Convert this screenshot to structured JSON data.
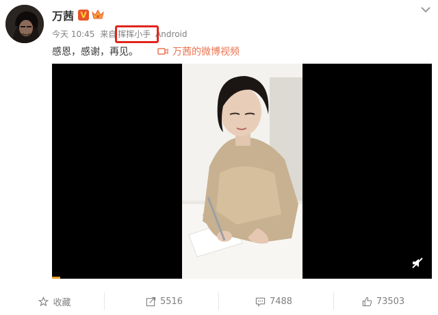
{
  "post": {
    "author": "万茜",
    "time": "今天 10:45",
    "from_label": "来自",
    "source": "挥挥小手",
    "device": "Android",
    "text": "感恩，感谢，再见。",
    "video_link": "万茜的微博视频"
  },
  "actions": {
    "favorite": "收藏",
    "repost": "5516",
    "comment": "7488",
    "like": "73503"
  },
  "colors": {
    "link": "#eb7350",
    "highlight": "#e0251b",
    "badge": "#e8542b",
    "video_bg": "#000000"
  },
  "icons": [
    "chevron-down-icon",
    "verified-v-icon",
    "crown-icon",
    "video-camera-icon",
    "mute-icon",
    "star-icon",
    "share-icon",
    "comment-icon",
    "thumbs-up-icon"
  ]
}
